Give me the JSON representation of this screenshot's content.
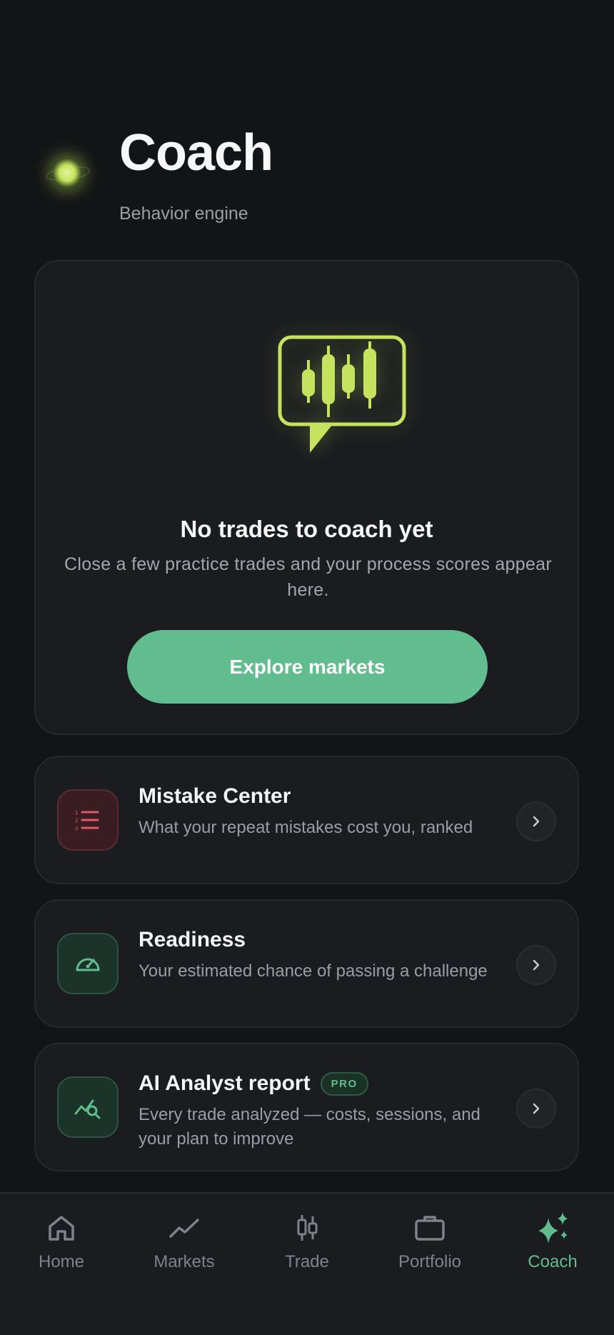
{
  "header": {
    "title": "Coach",
    "subtitle": "Behavior engine"
  },
  "empty_state": {
    "title": "No trades to coach yet",
    "description": "Close a few practice trades and your process scores appear here.",
    "button_label": "Explore markets"
  },
  "sections": [
    {
      "title": "Mistake Center",
      "description": "What your repeat mistakes cost you, ranked",
      "icon": "numbered-list-icon"
    },
    {
      "title": "Readiness",
      "description": "Your estimated chance of passing a challenge",
      "icon": "gauge-icon"
    },
    {
      "title": "AI Analyst report",
      "badge": "PRO",
      "description": "Every trade analyzed — costs, sessions, and your plan to improve",
      "icon": "chart-search-icon"
    }
  ],
  "tabs": [
    {
      "label": "Home",
      "icon": "home-icon"
    },
    {
      "label": "Markets",
      "icon": "trend-line-icon"
    },
    {
      "label": "Trade",
      "icon": "candlestick-icon"
    },
    {
      "label": "Portfolio",
      "icon": "briefcase-icon"
    },
    {
      "label": "Coach",
      "icon": "sparkles-icon",
      "active": true
    }
  ],
  "colors": {
    "background": "#131416",
    "card": "#1b1c1f",
    "accent_green": "#62bd8e",
    "lime": "#c6e35f",
    "danger": "#e0566b"
  }
}
